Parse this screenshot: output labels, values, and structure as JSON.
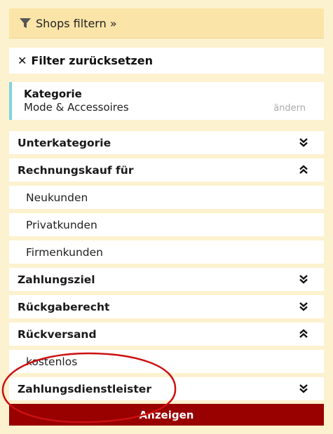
{
  "header": {
    "label": "Shops filtern »",
    "icon": "funnel-icon"
  },
  "reset": {
    "label": "Filter zurücksetzen",
    "icon": "x-icon"
  },
  "category": {
    "title": "Kategorie",
    "value": "Mode & Accessoires",
    "change_label": "ändern",
    "accent": "#7fd3df"
  },
  "filters": {
    "unterkategorie": {
      "label": "Unterkategorie",
      "state": "collapsed"
    },
    "rechnungskauf": {
      "label": "Rechnungskauf für",
      "state": "expanded",
      "options": [
        "Neukunden",
        "Privatkunden",
        "Firmenkunden"
      ]
    },
    "zahlungsziel": {
      "label": "Zahlungsziel",
      "state": "collapsed"
    },
    "rueckgaberecht": {
      "label": "Rückgaberecht",
      "state": "collapsed"
    },
    "rueckversand": {
      "label": "Rückversand",
      "state": "expanded",
      "options": [
        "kostenlos"
      ]
    },
    "zahlungsdienstleister": {
      "label": "Zahlungsdienstleister",
      "state": "collapsed"
    }
  },
  "submit": {
    "label": "Anzeigen",
    "color": "#990000"
  },
  "annotation_color": "#cc1111"
}
